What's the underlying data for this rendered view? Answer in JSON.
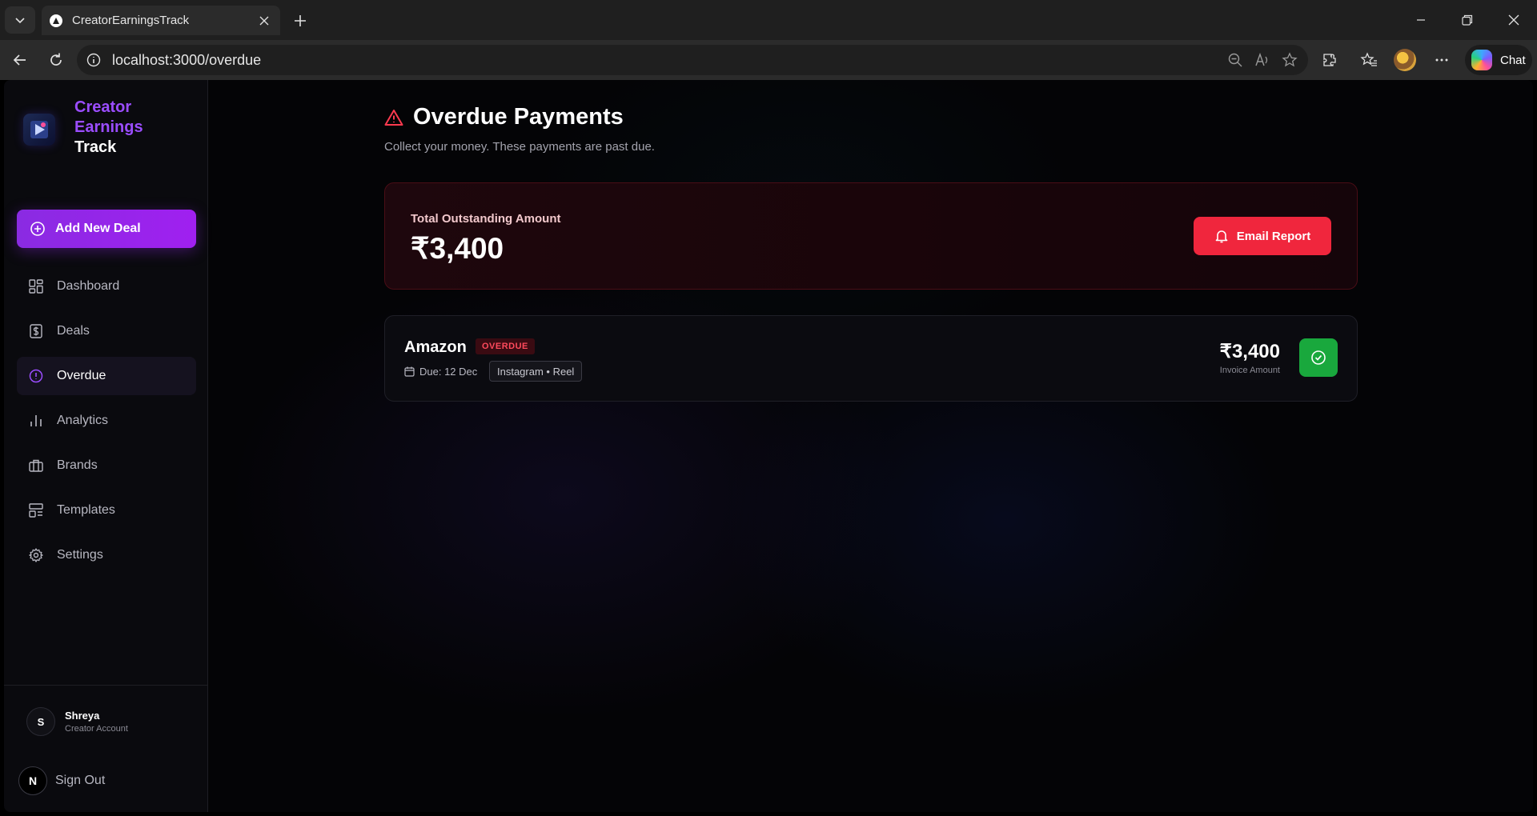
{
  "browser": {
    "tab_title": "CreatorEarningsTrack",
    "url": "localhost:3000/overdue",
    "chat_label": "Chat"
  },
  "sidebar": {
    "brand": {
      "line1": "Creator",
      "line2": "Earnings",
      "line3": "Track"
    },
    "add_deal_label": "Add New Deal",
    "items": [
      {
        "label": "Dashboard",
        "icon": "dashboard-icon",
        "active": false
      },
      {
        "label": "Deals",
        "icon": "dollar-icon",
        "active": false
      },
      {
        "label": "Overdue",
        "icon": "alert-circle-icon",
        "active": true
      },
      {
        "label": "Analytics",
        "icon": "bar-chart-icon",
        "active": false
      },
      {
        "label": "Brands",
        "icon": "briefcase-icon",
        "active": false
      },
      {
        "label": "Templates",
        "icon": "layout-icon",
        "active": false
      },
      {
        "label": "Settings",
        "icon": "gear-icon",
        "active": false
      }
    ],
    "user": {
      "initial": "S",
      "name": "Shreya",
      "role": "Creator Account"
    },
    "signout": {
      "initial": "N",
      "label": "Sign Out"
    }
  },
  "page": {
    "title": "Overdue Payments",
    "subtitle": "Collect your money. These payments are past due."
  },
  "summary": {
    "label": "Total Outstanding Amount",
    "amount": "₹3,400",
    "email_button": "Email Report"
  },
  "payments": [
    {
      "brand": "Amazon",
      "status": "OVERDUE",
      "due": "Due: 12 Dec",
      "platform": "Instagram • Reel",
      "amount": "₹3,400",
      "amount_label": "Invoice Amount"
    }
  ],
  "colors": {
    "accent_purple": "#9b4dff",
    "danger_red": "#f0263d",
    "success_green": "#19a83d"
  }
}
